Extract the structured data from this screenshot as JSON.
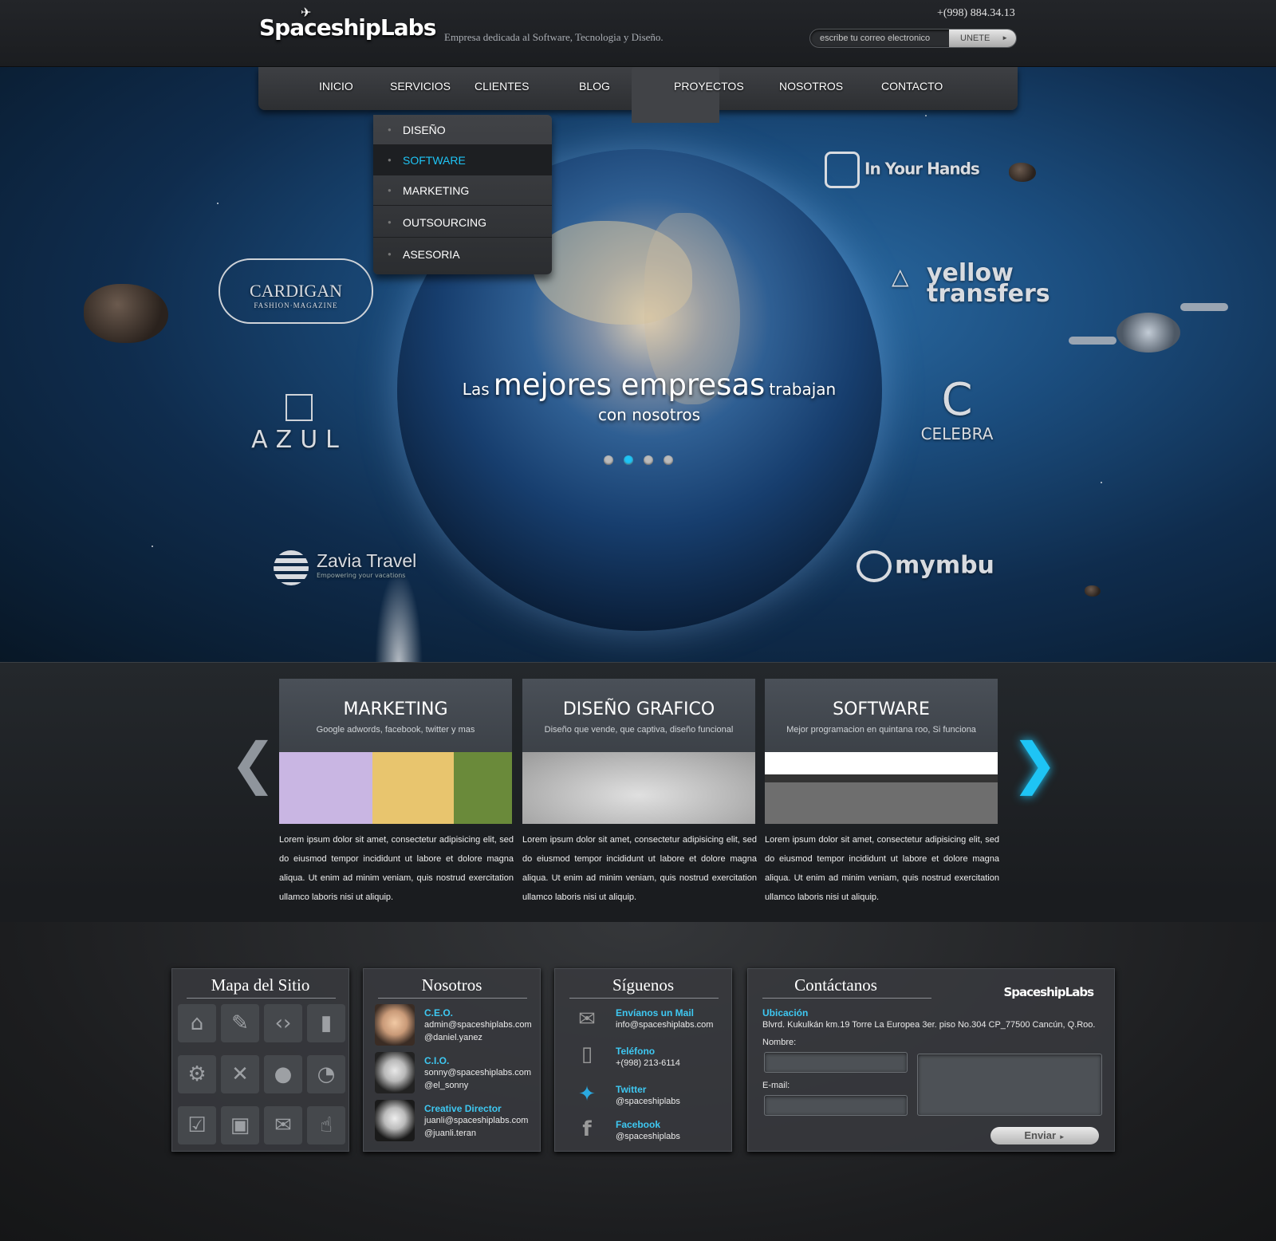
{
  "header": {
    "logo_text": "SpaceshipLabs",
    "tagline": "Empresa dedicada al Software, Tecnologia y Diseño.",
    "phone": "+(998) 884.34.13",
    "subscribe_placeholder": "escribe tu correo electronico",
    "subscribe_button": "UNETE"
  },
  "nav": {
    "items": [
      "INICIO",
      "SERVICIOS",
      "CLIENTES",
      "BLOG",
      "PROYECTOS",
      "NOSOTROS",
      "CONTACTO"
    ],
    "dropdown": [
      "DISEÑO",
      "SOFTWARE",
      "MARKETING",
      "OUTSOURCING",
      "ASESORIA"
    ],
    "active_item": "SERVICIOS",
    "active_dropdown": "SOFTWARE"
  },
  "hero": {
    "line1_pre": "Las",
    "line1_big": "mejores empresas",
    "line1_post": "trabajan",
    "line2": "con nosotros",
    "slider_count": 4,
    "slider_active": 2,
    "clients": [
      "In Your Hands",
      "yellow transfers",
      "CARDIGAN",
      "FASHION·MAGAZINE",
      "AZUL",
      "CELEBRA",
      "Zavia Travel",
      "Empowering your vacations",
      "mymbu"
    ]
  },
  "services": [
    {
      "title": "MARKETING",
      "subtitle": "Google adwords, facebook, twitter y mas",
      "text": "Lorem ipsum dolor sit amet, consectetur adipisicing elit, sed do eiusmod tempor incididunt ut labore et dolore magna aliqua. Ut enim ad minim veniam, quis nostrud exercitation ullamco laboris nisi ut aliquip."
    },
    {
      "title": "DISEÑO GRAFICO",
      "subtitle": "Diseño que vende, que captiva, diseño funcional",
      "text": "Lorem ipsum dolor sit amet, consectetur adipisicing elit, sed do eiusmod tempor incididunt ut labore et dolore magna aliqua. Ut enim ad minim veniam, quis nostrud exercitation ullamco laboris nisi ut aliquip."
    },
    {
      "title": "SOFTWARE",
      "subtitle": "Mejor programacion en quintana roo, Si funciona",
      "text": "Lorem ipsum dolor sit amet, consectetur adipisicing elit, sed do eiusmod tempor incididunt ut labore et dolore magna aliqua. Ut enim ad minim veniam, quis nostrud exercitation ullamco laboris nisi ut aliquip."
    }
  ],
  "footer": {
    "sitemap": {
      "title": "Mapa del Sitio",
      "icons": [
        "home-icon",
        "pencil-icon",
        "code-icon",
        "chart-icon",
        "gears-icon",
        "tools-icon",
        "user-icon",
        "chat-icon",
        "check-icon",
        "briefcase-icon",
        "mail-icon",
        "thumbs-up-icon"
      ]
    },
    "nosotros": {
      "title": "Nosotros",
      "people": [
        {
          "role": "C.E.O.",
          "email": "admin@spaceshiplabs.com",
          "handle": "@daniel.yanez"
        },
        {
          "role": "C.I.O.",
          "email": "sonny@spaceshiplabs.com",
          "handle": "@el_sonny"
        },
        {
          "role": "Creative Director",
          "email": "juanli@spaceshiplabs.com",
          "handle": "@juanli.teran"
        }
      ]
    },
    "siguenos": {
      "title": "Síguenos",
      "items": [
        {
          "label": "Envíanos un Mail",
          "value": "info@spaceshiplabs.com"
        },
        {
          "label": "Teléfono",
          "value": "+(998) 213-6114"
        },
        {
          "label": "Twitter",
          "value": "@spaceshiplabs"
        },
        {
          "label": "Facebook",
          "value": "@spaceshiplabs"
        }
      ]
    },
    "contacto": {
      "title": "Contáctanos",
      "logo": "SpaceshipLabs",
      "ubicacion_label": "Ubicación",
      "address": "Blvrd. Kukulkán km.19 Torre La Europea 3er. piso No.304 CP_77500 Cancún, Q.Roo.",
      "name_label": "Nombre:",
      "email_label": "E-mail:",
      "send_button": "Enviar"
    }
  },
  "colors": {
    "accent": "#1ec4f5",
    "link": "#3ec8f2"
  }
}
